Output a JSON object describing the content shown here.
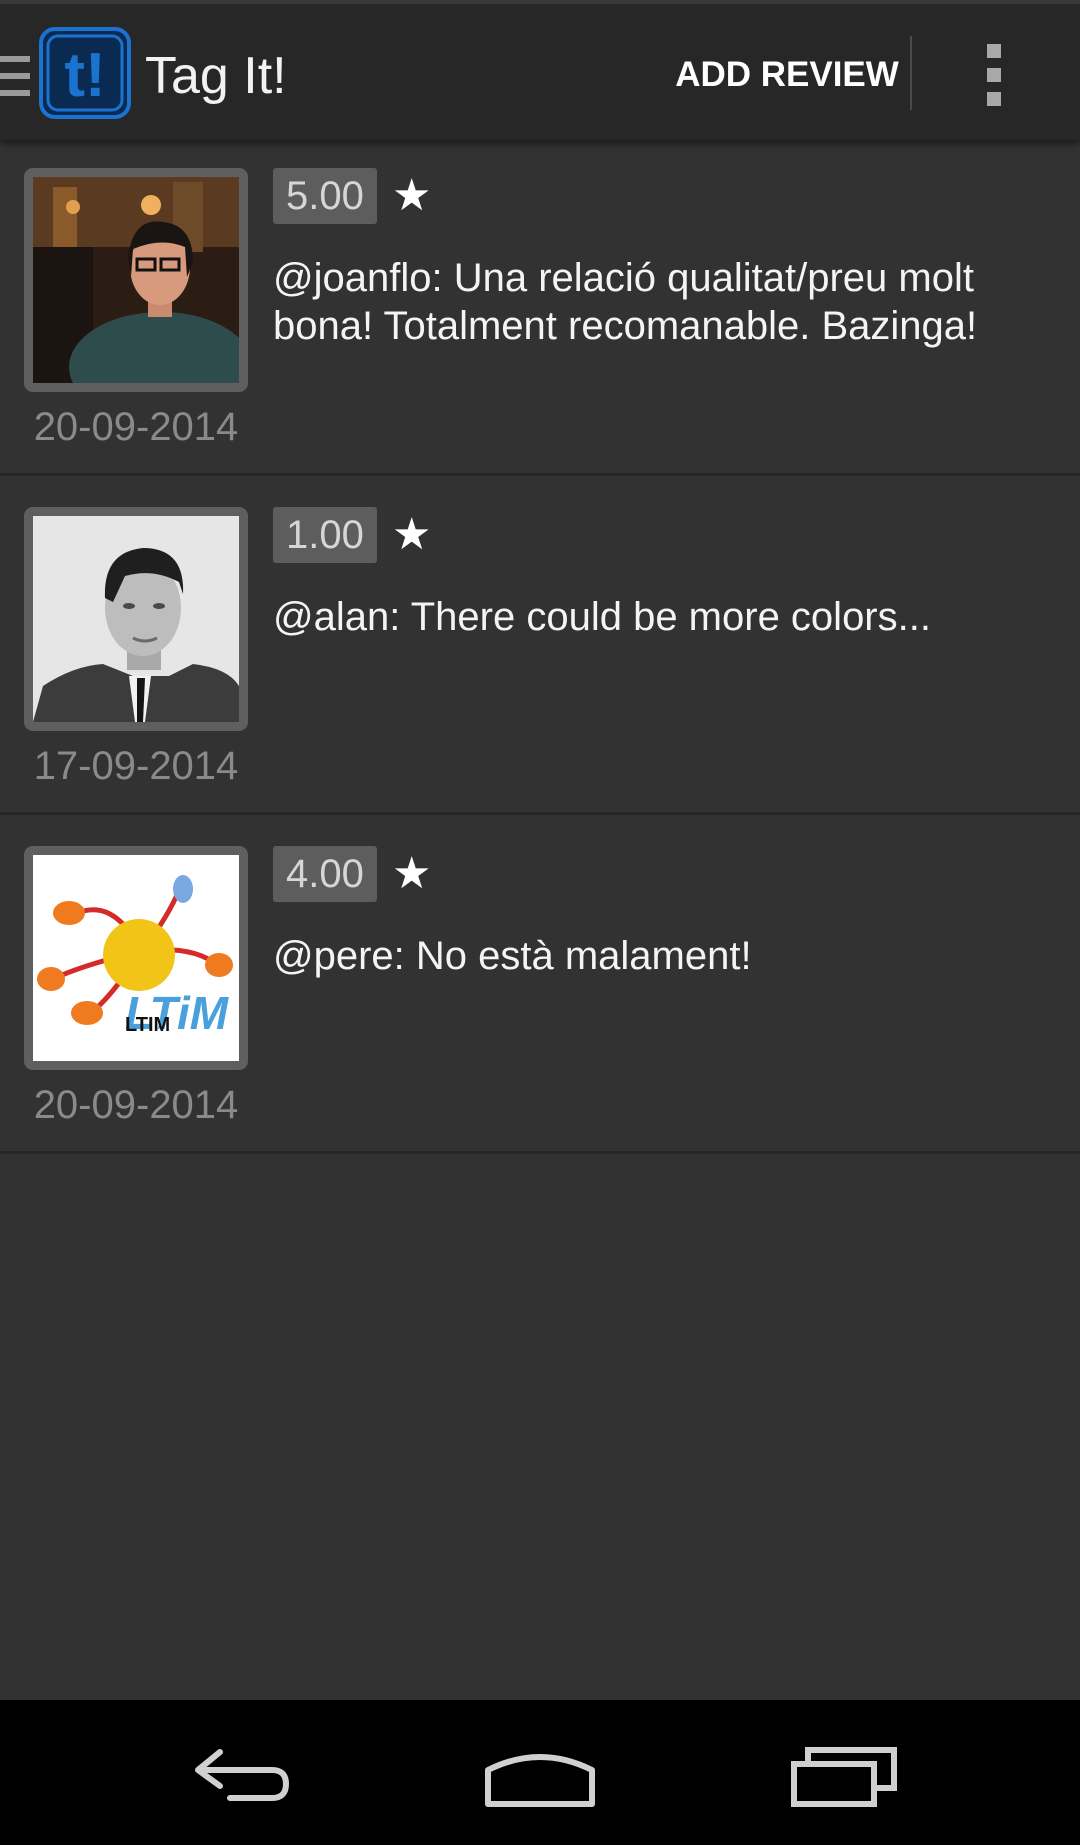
{
  "action_bar": {
    "title": "Tag It!",
    "logo_text": "t!",
    "add_review_label": "ADD REVIEW",
    "drawer_icon": "drawer-icon",
    "overflow_icon": "overflow-menu-icon"
  },
  "reviews": [
    {
      "rating": "5.00",
      "star": "★",
      "text": "@joanflo: Una relació qualitat/preu molt bona! Totalment recomanable. Bazinga!",
      "date": "20-09-2014",
      "avatar": "user-photo"
    },
    {
      "rating": "1.00",
      "star": "★",
      "text": "@alan: There could be more colors...",
      "date": "17-09-2014",
      "avatar": "user-photo-bw"
    },
    {
      "rating": "4.00",
      "star": "★",
      "text": "@pere: No està malament!",
      "date": "20-09-2014",
      "avatar": "ltim-logo",
      "avatar_text": "LTIM"
    }
  ],
  "nav_bar": {
    "back_icon": "back-icon",
    "home_icon": "home-icon",
    "recents_icon": "recents-icon"
  },
  "colors": {
    "background": "#323232",
    "action_bar": "#272727",
    "logo_blue": "#1b73d0",
    "badge": "#5d5d5d"
  }
}
